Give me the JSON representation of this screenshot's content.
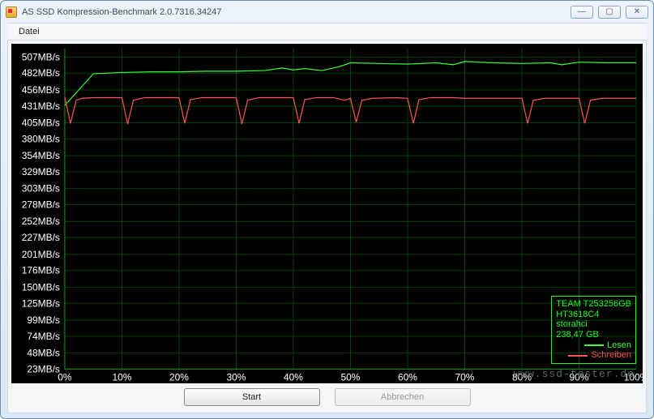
{
  "window": {
    "title": "AS SSD Kompression-Benchmark 2.0.7316.34247",
    "min_label": "—",
    "max_label": "▢",
    "close_label": "✕"
  },
  "menu": {
    "file": "Datei"
  },
  "buttons": {
    "start": "Start",
    "abort": "Abbrechen"
  },
  "legend": {
    "device": "TEAM T253256GB",
    "firmware": "HT3618C4",
    "mode": "storahci",
    "capacity": "238,47 GB",
    "read": "Lesen",
    "write": "Schreiben"
  },
  "watermark": "www.ssd-tester.de",
  "chart_data": {
    "type": "line",
    "xlabel": "",
    "ylabel": "",
    "x_unit": "%",
    "y_unit": "MB/s",
    "xlim": [
      0,
      100
    ],
    "ylim": [
      23,
      520
    ],
    "y_ticks": [
      507,
      482,
      456,
      431,
      405,
      380,
      354,
      329,
      303,
      278,
      252,
      227,
      201,
      176,
      150,
      125,
      99,
      74,
      48,
      23
    ],
    "y_tick_labels": [
      "507MB/s",
      "482MB/s",
      "456MB/s",
      "431MB/s",
      "405MB/s",
      "380MB/s",
      "354MB/s",
      "329MB/s",
      "303MB/s",
      "278MB/s",
      "252MB/s",
      "227MB/s",
      "201MB/s",
      "176MB/s",
      "150MB/s",
      "125MB/s",
      "99MB/s",
      "74MB/s",
      "48MB/s",
      "23MB/s"
    ],
    "x_ticks": [
      0,
      10,
      20,
      30,
      40,
      50,
      60,
      70,
      80,
      90,
      100
    ],
    "x_tick_labels": [
      "0%",
      "10%",
      "20%",
      "30%",
      "40%",
      "50%",
      "60%",
      "70%",
      "80%",
      "90%",
      "100%"
    ],
    "series": [
      {
        "name": "Lesen",
        "color": "#33ff33",
        "x": [
          0,
          5,
          10,
          15,
          20,
          25,
          30,
          35,
          38,
          40,
          42,
          45,
          48,
          50,
          55,
          60,
          65,
          68,
          70,
          75,
          80,
          85,
          87,
          90,
          95,
          100
        ],
        "y": [
          432,
          481,
          483,
          484,
          484,
          485,
          485,
          486,
          490,
          487,
          489,
          486,
          492,
          498,
          497,
          496,
          498,
          495,
          500,
          498,
          497,
          498,
          495,
          499,
          498,
          498
        ]
      },
      {
        "name": "Schreiben",
        "color": "#ff5555",
        "x": [
          0,
          1,
          2,
          3,
          5,
          8,
          10,
          11,
          12,
          14,
          18,
          20,
          21,
          22,
          24,
          28,
          30,
          31,
          32,
          34,
          38,
          40,
          41,
          42,
          44,
          47,
          49,
          50,
          51,
          52,
          54,
          58,
          60,
          61,
          62,
          64,
          68,
          70,
          75,
          78,
          80,
          81,
          82,
          84,
          88,
          90,
          91,
          92,
          94,
          98,
          100
        ],
        "y": [
          445,
          404,
          440,
          443,
          444,
          444,
          444,
          403,
          440,
          444,
          444,
          444,
          404,
          441,
          444,
          444,
          444,
          403,
          440,
          444,
          444,
          444,
          404,
          441,
          444,
          444,
          440,
          443,
          406,
          440,
          443,
          444,
          443,
          404,
          441,
          444,
          444,
          443,
          443,
          443,
          443,
          404,
          440,
          443,
          443,
          443,
          404,
          440,
          443,
          443,
          443
        ]
      }
    ]
  }
}
